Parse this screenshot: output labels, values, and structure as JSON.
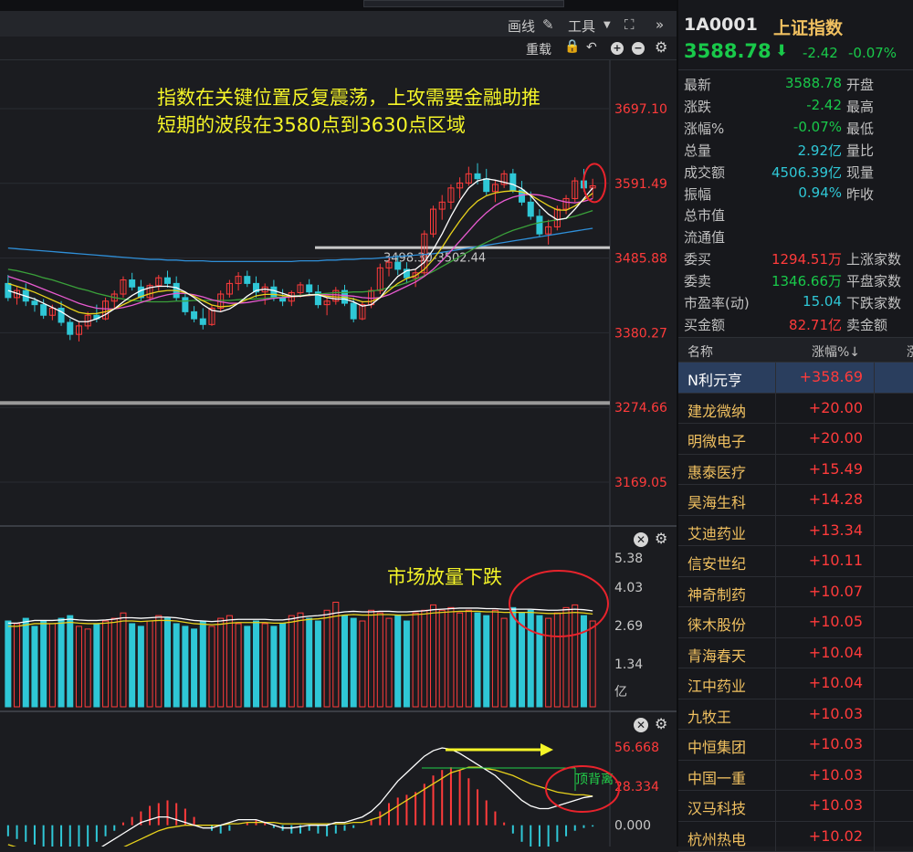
{
  "toolbar": {
    "draw_label": "画线",
    "tools_label": "工具",
    "reset_label": "重载"
  },
  "main_chart": {
    "price_ticks": [
      "3697.10",
      "3591.49",
      "3485.88",
      "3380.27",
      "3274.66",
      "3169.05"
    ],
    "range_label": "3498.30-3502.44",
    "annotation_line1": "指数在关键位置反复震荡，上攻需要金融助推",
    "annotation_line2": "短期的波段在3580点到3630点区域"
  },
  "volume_panel": {
    "ticks": [
      "5.38",
      "4.03",
      "2.69",
      "1.34",
      "亿"
    ],
    "annotation": "市场放量下跌"
  },
  "macd_panel": {
    "ticks": [
      "56.668",
      "28.334",
      "0.000"
    ],
    "divergence_label": "顶背离"
  },
  "colors": {
    "up": "#ff3b3b",
    "down": "#2fc7d6",
    "annotation": "#f5f528",
    "highlight_circle": "#e8232c",
    "down_text": "#19c94a",
    "up_text": "#ff3b3b"
  },
  "chart_data": {
    "type": "candlestick",
    "title": "",
    "ylim": [
      3169.05,
      3697.1
    ],
    "ohlc": [
      [
        3450,
        3462,
        3425,
        3430
      ],
      [
        3430,
        3445,
        3420,
        3440
      ],
      [
        3440,
        3450,
        3418,
        3425
      ],
      [
        3425,
        3430,
        3410,
        3420
      ],
      [
        3420,
        3428,
        3400,
        3405
      ],
      [
        3405,
        3420,
        3398,
        3415
      ],
      [
        3415,
        3425,
        3390,
        3395
      ],
      [
        3395,
        3400,
        3370,
        3378
      ],
      [
        3378,
        3395,
        3368,
        3390
      ],
      [
        3390,
        3410,
        3385,
        3405
      ],
      [
        3405,
        3420,
        3395,
        3400
      ],
      [
        3400,
        3430,
        3398,
        3425
      ],
      [
        3425,
        3440,
        3415,
        3435
      ],
      [
        3435,
        3460,
        3430,
        3455
      ],
      [
        3455,
        3465,
        3440,
        3445
      ],
      [
        3445,
        3455,
        3425,
        3430
      ],
      [
        3430,
        3450,
        3425,
        3447
      ],
      [
        3447,
        3462,
        3440,
        3458
      ],
      [
        3458,
        3468,
        3444,
        3450
      ],
      [
        3450,
        3460,
        3425,
        3430
      ],
      [
        3430,
        3438,
        3405,
        3410
      ],
      [
        3410,
        3418,
        3395,
        3400
      ],
      [
        3400,
        3415,
        3385,
        3392
      ],
      [
        3392,
        3420,
        3390,
        3415
      ],
      [
        3415,
        3440,
        3410,
        3435
      ],
      [
        3435,
        3455,
        3430,
        3450
      ],
      [
        3450,
        3466,
        3440,
        3460
      ],
      [
        3460,
        3468,
        3445,
        3450
      ],
      [
        3450,
        3460,
        3430,
        3438
      ],
      [
        3438,
        3450,
        3420,
        3445
      ],
      [
        3445,
        3455,
        3425,
        3430
      ],
      [
        3430,
        3442,
        3418,
        3425
      ],
      [
        3425,
        3440,
        3418,
        3437
      ],
      [
        3437,
        3452,
        3430,
        3448
      ],
      [
        3448,
        3456,
        3432,
        3438
      ],
      [
        3438,
        3448,
        3415,
        3420
      ],
      [
        3420,
        3430,
        3405,
        3425
      ],
      [
        3425,
        3445,
        3420,
        3440
      ],
      [
        3440,
        3448,
        3418,
        3422
      ],
      [
        3422,
        3430,
        3395,
        3400
      ],
      [
        3400,
        3425,
        3398,
        3420
      ],
      [
        3420,
        3445,
        3415,
        3440
      ],
      [
        3440,
        3478,
        3435,
        3472
      ],
      [
        3472,
        3488,
        3460,
        3480
      ],
      [
        3480,
        3490,
        3462,
        3470
      ],
      [
        3470,
        3480,
        3450,
        3458
      ],
      [
        3458,
        3470,
        3445,
        3465
      ],
      [
        3465,
        3525,
        3460,
        3520
      ],
      [
        3520,
        3560,
        3515,
        3555
      ],
      [
        3555,
        3575,
        3540,
        3565
      ],
      [
        3565,
        3590,
        3555,
        3585
      ],
      [
        3585,
        3600,
        3570,
        3592
      ],
      [
        3592,
        3615,
        3588,
        3605
      ],
      [
        3605,
        3620,
        3590,
        3598
      ],
      [
        3598,
        3612,
        3575,
        3580
      ],
      [
        3580,
        3595,
        3565,
        3590
      ],
      [
        3590,
        3610,
        3585,
        3605
      ],
      [
        3605,
        3612,
        3578,
        3582
      ],
      [
        3582,
        3595,
        3560,
        3565
      ],
      [
        3565,
        3580,
        3540,
        3545
      ],
      [
        3545,
        3555,
        3515,
        3520
      ],
      [
        3520,
        3540,
        3505,
        3530
      ],
      [
        3530,
        3560,
        3525,
        3555
      ],
      [
        3555,
        3575,
        3548,
        3570
      ],
      [
        3570,
        3600,
        3565,
        3595
      ],
      [
        3595,
        3612,
        3580,
        3585
      ],
      [
        3585,
        3598,
        3570,
        3588
      ]
    ],
    "ma_short": [
      3440,
      3436,
      3432,
      3428,
      3422,
      3416,
      3410,
      3402,
      3396,
      3396,
      3400,
      3406,
      3414,
      3424,
      3433,
      3440,
      3444,
      3446,
      3446,
      3444,
      3438,
      3430,
      3420,
      3412,
      3410,
      3414,
      3422,
      3432,
      3440,
      3442,
      3440,
      3436,
      3432,
      3432,
      3434,
      3434,
      3430,
      3428,
      3428,
      3424,
      3418,
      3420,
      3430,
      3446,
      3460,
      3468,
      3470,
      3480,
      3498,
      3520,
      3545,
      3567,
      3585,
      3595,
      3598,
      3596,
      3593,
      3590,
      3584,
      3574,
      3560,
      3548,
      3540,
      3542,
      3555,
      3570,
      3585
    ],
    "ma_mid": [
      3460,
      3456,
      3452,
      3447,
      3442,
      3437,
      3432,
      3427,
      3422,
      3418,
      3415,
      3414,
      3414,
      3416,
      3419,
      3423,
      3427,
      3431,
      3434,
      3436,
      3436,
      3434,
      3431,
      3427,
      3424,
      3422,
      3422,
      3423,
      3425,
      3427,
      3429,
      3430,
      3431,
      3432,
      3433,
      3434,
      3434,
      3434,
      3433,
      3432,
      3430,
      3429,
      3430,
      3434,
      3440,
      3446,
      3452,
      3460,
      3470,
      3482,
      3496,
      3510,
      3524,
      3538,
      3550,
      3560,
      3567,
      3572,
      3575,
      3576,
      3575,
      3572,
      3568,
      3565,
      3564,
      3566,
      3570
    ],
    "ma_long": [
      3470,
      3468,
      3465,
      3462,
      3458,
      3455,
      3451,
      3447,
      3443,
      3440,
      3436,
      3433,
      3430,
      3428,
      3426,
      3425,
      3424,
      3424,
      3424,
      3425,
      3425,
      3426,
      3426,
      3426,
      3426,
      3426,
      3427,
      3428,
      3428,
      3429,
      3430,
      3431,
      3432,
      3433,
      3434,
      3435,
      3436,
      3437,
      3437,
      3438,
      3438,
      3439,
      3441,
      3444,
      3447,
      3451,
      3456,
      3461,
      3467,
      3474,
      3481,
      3488,
      3495,
      3502,
      3508,
      3514,
      3520,
      3525,
      3529,
      3533,
      3536,
      3538,
      3540,
      3542,
      3545,
      3549,
      3553
    ],
    "ma_xlong": [
      3500,
      3499,
      3498,
      3497,
      3496,
      3495,
      3494,
      3493,
      3492,
      3491,
      3490,
      3489,
      3488,
      3487,
      3486,
      3485,
      3484,
      3484,
      3483,
      3483,
      3482,
      3482,
      3482,
      3481,
      3481,
      3481,
      3481,
      3481,
      3481,
      3481,
      3481,
      3481,
      3481,
      3482,
      3482,
      3482,
      3483,
      3483,
      3484,
      3484,
      3485,
      3485,
      3486,
      3487,
      3488,
      3489,
      3490,
      3491,
      3492,
      3494,
      3496,
      3498,
      3500,
      3502,
      3504,
      3506,
      3508,
      3510,
      3512,
      3514,
      3516,
      3518,
      3520,
      3522,
      3524,
      3526,
      3528
    ],
    "volume": {
      "ylim": [
        0,
        5.38
      ],
      "values": [
        3.2,
        3.1,
        3.3,
        3.0,
        3.2,
        3.1,
        3.3,
        3.4,
        3.0,
        2.9,
        3.1,
        3.2,
        3.3,
        3.5,
        3.1,
        3.0,
        3.2,
        3.4,
        3.3,
        3.1,
        3.0,
        2.9,
        3.2,
        3.0,
        3.3,
        3.4,
        3.1,
        3.0,
        3.2,
        3.1,
        3.0,
        3.1,
        3.4,
        3.5,
        3.3,
        3.2,
        3.6,
        3.9,
        3.4,
        3.3,
        3.2,
        3.6,
        3.5,
        3.3,
        3.4,
        3.2,
        3.5,
        3.6,
        3.8,
        3.6,
        3.7,
        3.5,
        3.6,
        3.5,
        3.4,
        3.6,
        3.3,
        3.7,
        3.5,
        3.6,
        3.4,
        3.3,
        3.5,
        3.7,
        3.8,
        3.4,
        3.2
      ],
      "ma": [
        3.0,
        3.0,
        3.05,
        3.1,
        3.1,
        3.1,
        3.12,
        3.15,
        3.12,
        3.1,
        3.1,
        3.12,
        3.15,
        3.2,
        3.2,
        3.18,
        3.2,
        3.22,
        3.22,
        3.2,
        3.15,
        3.1,
        3.08,
        3.06,
        3.08,
        3.12,
        3.14,
        3.14,
        3.14,
        3.14,
        3.12,
        3.12,
        3.16,
        3.22,
        3.26,
        3.28,
        3.32,
        3.38,
        3.42,
        3.44,
        3.42,
        3.42,
        3.44,
        3.44,
        3.42,
        3.42,
        3.44,
        3.46,
        3.5,
        3.52,
        3.54,
        3.56,
        3.56,
        3.56,
        3.54,
        3.54,
        3.52,
        3.52,
        3.52,
        3.52,
        3.5,
        3.48,
        3.48,
        3.5,
        3.52,
        3.5,
        3.46
      ]
    },
    "macd": {
      "ylim": [
        -28,
        56.668
      ],
      "hist": [
        -8,
        -10,
        -12,
        -14,
        -16,
        -18,
        -20,
        -22,
        -20,
        -16,
        -12,
        -8,
        -4,
        2,
        6,
        10,
        14,
        16,
        18,
        16,
        12,
        6,
        0,
        -4,
        -6,
        -4,
        0,
        2,
        4,
        2,
        -2,
        -4,
        -6,
        -6,
        -4,
        -6,
        -8,
        -6,
        -4,
        -2,
        0,
        4,
        10,
        16,
        20,
        22,
        24,
        30,
        36,
        40,
        42,
        40,
        34,
        26,
        18,
        10,
        2,
        -6,
        -12,
        -16,
        -18,
        -16,
        -12,
        -8,
        -4,
        -2,
        -1
      ],
      "dif": [
        -20,
        -24,
        -28,
        -30,
        -30,
        -28,
        -26,
        -24,
        -24,
        -22,
        -18,
        -14,
        -10,
        -6,
        -2,
        2,
        4,
        6,
        6,
        4,
        2,
        0,
        -2,
        -2,
        0,
        2,
        4,
        4,
        4,
        2,
        0,
        -2,
        -2,
        -1,
        0,
        0,
        0,
        2,
        2,
        4,
        6,
        10,
        16,
        24,
        32,
        38,
        44,
        50,
        54,
        56,
        55,
        52,
        48,
        44,
        40,
        36,
        30,
        24,
        18,
        14,
        12,
        12,
        14,
        16,
        18,
        20,
        21
      ],
      "dea": [
        -14,
        -16,
        -18,
        -20,
        -22,
        -23,
        -24,
        -24,
        -24,
        -23,
        -22,
        -20,
        -18,
        -16,
        -13,
        -10,
        -7,
        -4,
        -2,
        -1,
        0,
        0,
        0,
        0,
        0,
        1,
        1,
        2,
        2,
        2,
        2,
        1,
        1,
        1,
        1,
        1,
        1,
        1,
        1,
        2,
        2,
        4,
        6,
        10,
        14,
        18,
        22,
        26,
        30,
        34,
        38,
        40,
        42,
        42,
        41,
        40,
        38,
        36,
        33,
        30,
        28,
        26,
        24,
        23,
        22,
        22,
        21
      ]
    }
  },
  "quote": {
    "code": "1A0001",
    "name": "上证指数",
    "price": "3588.78",
    "change": "-2.42",
    "change_pct": "-0.07%",
    "rows": [
      {
        "label": "最新",
        "value": "3588.78",
        "label2": "开盘",
        "color": "#19c94a"
      },
      {
        "label": "涨跌",
        "value": "-2.42",
        "label2": "最高",
        "color": "#19c94a"
      },
      {
        "label": "涨幅%",
        "value": "-0.07%",
        "label2": "最低",
        "color": "#19c94a"
      },
      {
        "label": "总量",
        "value": "2.92亿",
        "label2": "量比",
        "color": "#2fc7d6"
      },
      {
        "label": "成交额",
        "value": "4506.39亿",
        "label2": "现量",
        "color": "#2fc7d6"
      },
      {
        "label": "振幅",
        "value": "0.94%",
        "label2": "昨收",
        "color": "#2fc7d6"
      },
      {
        "label": "总市值",
        "value": "",
        "label2": "",
        "color": "#2fc7d6"
      },
      {
        "label": "流通值",
        "value": "",
        "label2": "",
        "color": "#2fc7d6"
      },
      {
        "label": "委买",
        "value": "1294.51万",
        "label2": "上涨家数",
        "color": "#ff3b3b"
      },
      {
        "label": "委卖",
        "value": "1346.66万",
        "label2": "平盘家数",
        "color": "#19c94a"
      },
      {
        "label": "市盈率(动)",
        "value": "15.04",
        "label2": "下跌家数",
        "color": "#2fc7d6"
      },
      {
        "label": "买金额",
        "value": "82.71亿",
        "label2": "卖金额",
        "color": "#ff3b3b"
      }
    ]
  },
  "stock_list": {
    "col_name": "名称",
    "col_pct": "涨幅%↓",
    "col_more": "涨",
    "rows": [
      {
        "name": "N利元亨",
        "pct": "+358.69"
      },
      {
        "name": "建龙微纳",
        "pct": "+20.00"
      },
      {
        "name": "明微电子",
        "pct": "+20.00"
      },
      {
        "name": "惠泰医疗",
        "pct": "+15.49"
      },
      {
        "name": "昊海生科",
        "pct": "+14.28"
      },
      {
        "name": "艾迪药业",
        "pct": "+13.34"
      },
      {
        "name": "信安世纪",
        "pct": "+10.11"
      },
      {
        "name": "神奇制药",
        "pct": "+10.07"
      },
      {
        "name": "徕木股份",
        "pct": "+10.05"
      },
      {
        "name": "青海春天",
        "pct": "+10.04"
      },
      {
        "name": "江中药业",
        "pct": "+10.04"
      },
      {
        "name": "九牧王",
        "pct": "+10.03"
      },
      {
        "name": "中恒集团",
        "pct": "+10.03"
      },
      {
        "name": "中国一重",
        "pct": "+10.03"
      },
      {
        "name": "汉马科技",
        "pct": "+10.03"
      },
      {
        "name": "杭州热电",
        "pct": "+10.02"
      }
    ]
  }
}
